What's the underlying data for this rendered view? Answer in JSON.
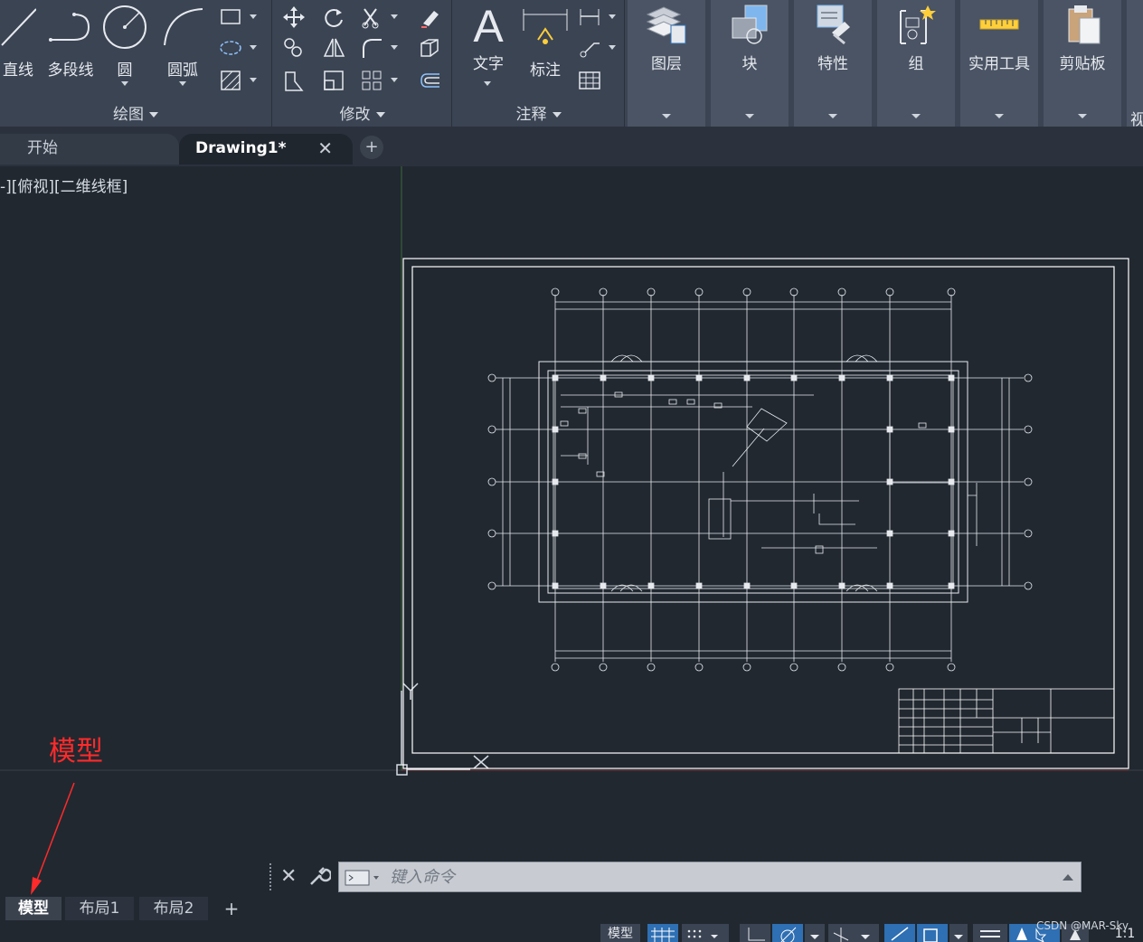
{
  "ribbon": {
    "draw_panel": {
      "title": "绘图",
      "tools": {
        "line": "直线",
        "polyline": "多段线",
        "circle": "圆",
        "arc": "圆弧"
      }
    },
    "modify_panel": {
      "title": "修改"
    },
    "annotation_panel": {
      "title": "注释",
      "tools": {
        "text": "文字",
        "dimension": "标注"
      }
    },
    "big_panels": {
      "layers": "图层",
      "block": "块",
      "properties": "特性",
      "group": "组",
      "utilities": "实用工具",
      "clipboard": "剪贴板",
      "view": "视"
    }
  },
  "file_tabs": {
    "start": "开始",
    "drawing": "Drawing1*",
    "close": "✕",
    "add": "+"
  },
  "viewport": {
    "label": "-][俯视][二维线框]"
  },
  "annotation": {
    "model_callout": "模型"
  },
  "command_line": {
    "close": "✕",
    "placeholder": "键入命令"
  },
  "layout_tabs": {
    "model": "模型",
    "layout1": "布局1",
    "layout2": "布局2",
    "add": "+"
  },
  "status_bar": {
    "model": "模型",
    "scale": "1:1"
  },
  "watermark": "CSDN @MAR-Sky",
  "colors": {
    "ribbon_bg": "#3b4453",
    "canvas_bg": "#212830",
    "annotation_red": "#ff2a2a",
    "active_blue": "#2f6fb3"
  }
}
